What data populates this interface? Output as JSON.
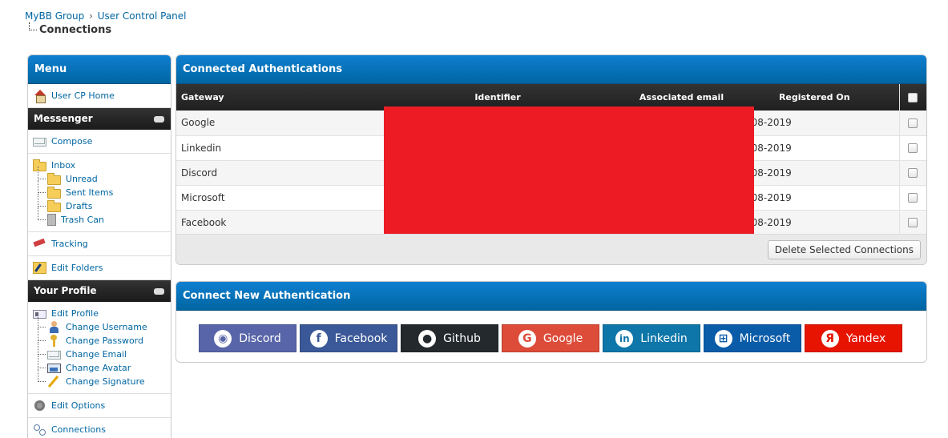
{
  "breadcrumb": {
    "crumbs": [
      "MyBB Group",
      "User Control Panel"
    ],
    "separator": "›",
    "active": "Connections"
  },
  "sidebar": {
    "title": "Menu",
    "home": "User CP Home",
    "messenger": {
      "title": "Messenger",
      "compose": "Compose",
      "inbox": "Inbox",
      "folders": [
        "Unread",
        "Sent Items",
        "Drafts",
        "Trash Can"
      ],
      "tracking": "Tracking",
      "edit_folders": "Edit Folders"
    },
    "profile": {
      "title": "Your Profile",
      "edit_profile": "Edit Profile",
      "subitems": [
        "Change Username",
        "Change Password",
        "Change Email",
        "Change Avatar",
        "Change Signature"
      ],
      "edit_options": "Edit Options",
      "connections": "Connections"
    }
  },
  "connected": {
    "title": "Connected Authentications",
    "columns": [
      "Gateway",
      "Identifier",
      "Associated email",
      "Registered On"
    ],
    "rows": [
      {
        "gateway": "Google",
        "registered": "11-08-2019"
      },
      {
        "gateway": "Linkedin",
        "registered": "13-08-2019"
      },
      {
        "gateway": "Discord",
        "registered": "11-08-2019"
      },
      {
        "gateway": "Microsoft",
        "registered": "13-08-2019"
      },
      {
        "gateway": "Facebook",
        "registered": "13-08-2019"
      }
    ],
    "delete_button": "Delete Selected Connections",
    "redaction_color": "#ed1c24"
  },
  "connect_new": {
    "title": "Connect New Authentication",
    "providers": [
      {
        "label": "Discord",
        "color": "#5865a8",
        "icon": "discord-icon"
      },
      {
        "label": "Facebook",
        "color": "#3b5998",
        "icon": "facebook-icon"
      },
      {
        "label": "Github",
        "color": "#24292e",
        "icon": "github-icon"
      },
      {
        "label": "Google",
        "color": "#dd4b39",
        "icon": "google-icon"
      },
      {
        "label": "Linkedin",
        "color": "#0e76a8",
        "icon": "linkedin-icon"
      },
      {
        "label": "Microsoft",
        "color": "#0b5ca8",
        "icon": "microsoft-icon"
      },
      {
        "label": "Yandex",
        "color": "#e61400",
        "icon": "yandex-icon"
      }
    ]
  },
  "colors": {
    "header_blue": "#0066a2",
    "link": "#0066a2",
    "dark_header": "#222222"
  }
}
